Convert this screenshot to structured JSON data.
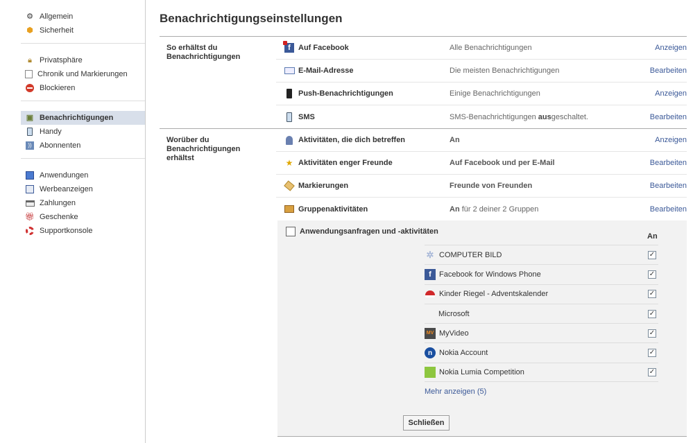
{
  "sidebar": {
    "groups": [
      [
        {
          "label": "Allgemein",
          "icon": "gears-icon"
        },
        {
          "label": "Sicherheit",
          "icon": "badge-icon"
        }
      ],
      [
        {
          "label": "Privatsphäre",
          "icon": "lock-icon"
        },
        {
          "label": "Chronik und Markierungen",
          "icon": "timeline-icon"
        },
        {
          "label": "Blockieren",
          "icon": "block-icon"
        }
      ],
      [
        {
          "label": "Benachrichtigungen",
          "icon": "notification-icon",
          "active": true
        },
        {
          "label": "Handy",
          "icon": "phone-icon"
        },
        {
          "label": "Abonnenten",
          "icon": "rss-icon"
        }
      ],
      [
        {
          "label": "Anwendungen",
          "icon": "cube-icon"
        },
        {
          "label": "Werbeanzeigen",
          "icon": "ads-icon"
        },
        {
          "label": "Zahlungen",
          "icon": "card-icon"
        },
        {
          "label": "Geschenke",
          "icon": "gift-icon"
        },
        {
          "label": "Supportkonsole",
          "icon": "lifebuoy-icon"
        }
      ]
    ]
  },
  "main": {
    "title": "Benachrichtigungseinstellungen",
    "section1": {
      "label": "So erhältst du Benachrichtigungen",
      "rows": [
        {
          "icon": "facebook-icon",
          "title": "Auf Facebook",
          "status": "Alle Benachrichtigungen",
          "action": "Anzeigen"
        },
        {
          "icon": "mail-icon",
          "title": "E-Mail-Adresse",
          "status": "Die meisten Benachrichtigungen",
          "action": "Bearbeiten"
        },
        {
          "icon": "mobile-icon",
          "title": "Push-Benachrichtigungen",
          "status": "Einige Benachrichtigungen",
          "action": "Anzeigen"
        },
        {
          "icon": "sms-icon",
          "title": "SMS",
          "status_pre": "SMS-Benachrichtigungen ",
          "status_bold": "aus",
          "status_post": "geschaltet.",
          "action": "Bearbeiten"
        }
      ]
    },
    "section2": {
      "label": "Worüber du Benachrichtigungen erhältst",
      "rows": [
        {
          "icon": "user-icon",
          "title": "Aktivitäten, die dich betreffen",
          "status": "An",
          "action": "Anzeigen"
        },
        {
          "icon": "star-icon",
          "title": "Aktivitäten enger Freunde",
          "status": "Auf Facebook und per E-Mail",
          "action": "Bearbeiten"
        },
        {
          "icon": "tag-icon",
          "title": "Markierungen",
          "status": "Freunde von Freunden",
          "action": "Bearbeiten"
        },
        {
          "icon": "group-icon",
          "title": "Gruppenaktivitäten",
          "status_bold": "An",
          "status_post": " für 2 deiner 2 Gruppen",
          "action": "Bearbeiten"
        }
      ]
    },
    "apps": {
      "title": "Anwendungsanfragen und -aktivitäten",
      "column_header": "An",
      "items": [
        {
          "name": "COMPUTER BILD",
          "color": "#a8b8d8",
          "checked": true
        },
        {
          "name": "Facebook for Windows Phone",
          "color": "#3b5998",
          "checked": true
        },
        {
          "name": "Kinder Riegel - Adventskalender",
          "color": "#d0282a",
          "checked": true
        },
        {
          "name": "Microsoft",
          "color": "#f25022",
          "checked": true
        },
        {
          "name": "MyVideo",
          "color": "#4a4a4a",
          "checked": true
        },
        {
          "name": "Nokia Account",
          "color": "#1a4fa0",
          "checked": true
        },
        {
          "name": "Nokia Lumia Competition",
          "color": "#8dc63f",
          "checked": true
        }
      ],
      "more_link": "Mehr anzeigen (5)",
      "close_label": "Schließen"
    }
  }
}
